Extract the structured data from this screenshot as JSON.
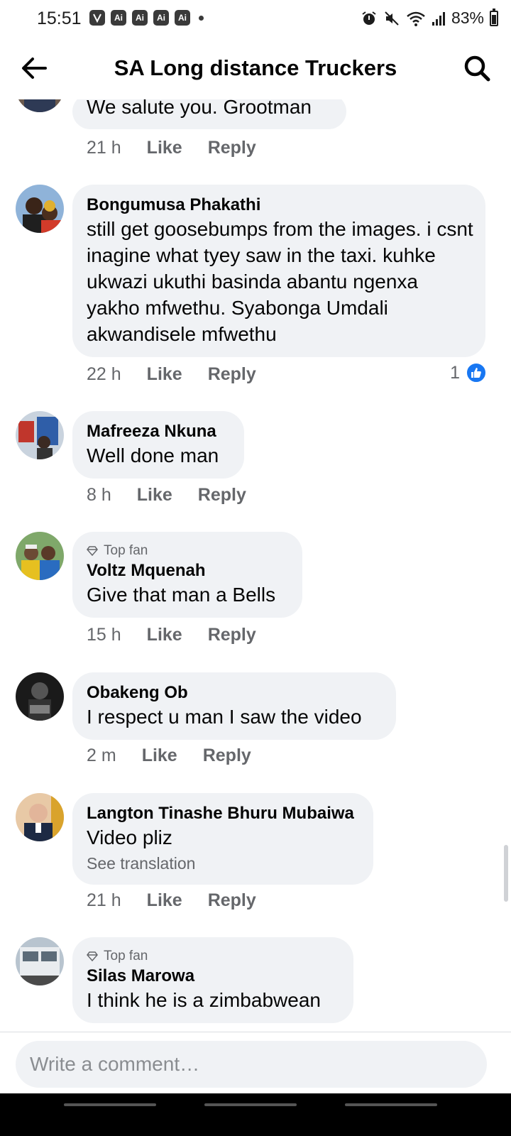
{
  "status_bar": {
    "time": "15:51",
    "app_badges": [
      "Ai",
      "Ai",
      "Ai",
      "Ai"
    ],
    "battery": "83%"
  },
  "header": {
    "title": "SA Long distance Truckers",
    "back_icon": "arrow-left-icon",
    "search_icon": "search-icon"
  },
  "comments": [
    {
      "author": "",
      "text": "We salute you.  Grootman",
      "time": "21 h",
      "like": "Like",
      "reply": "Reply"
    },
    {
      "author": "Bongumusa Phakathi",
      "text": "still get goosebumps from the images. i csnt inagine what tyey saw in the taxi. kuhke ukwazi ukuthi basinda abantu ngenxa yakho mfwethu. Syabonga Umdali akwandisele mfwethu",
      "time": "22 h",
      "like": "Like",
      "reply": "Reply",
      "reaction_count": "1"
    },
    {
      "author": "Mafreeza Nkuna",
      "text": "Well done man",
      "time": "8 h",
      "like": "Like",
      "reply": "Reply"
    },
    {
      "badge": "Top fan",
      "author": "Voltz Mquenah",
      "text": "Give that man a Bells",
      "time": "15 h",
      "like": "Like",
      "reply": "Reply"
    },
    {
      "author": "Obakeng Ob",
      "text": "I respect u man I saw the video",
      "time": "2 m",
      "like": "Like",
      "reply": "Reply"
    },
    {
      "author": "Langton Tinashe Bhuru Mubaiwa",
      "text": "Video pliz",
      "see_translation": "See translation",
      "time": "21 h",
      "like": "Like",
      "reply": "Reply"
    },
    {
      "badge": "Top fan",
      "author": "Silas Marowa",
      "text": "I think he is a zimbabwean"
    }
  ],
  "composer": {
    "placeholder": "Write a comment…"
  },
  "colors": {
    "bubble": "#f0f2f5",
    "secondary_text": "#65676b",
    "like_blue": "#1877f2"
  }
}
